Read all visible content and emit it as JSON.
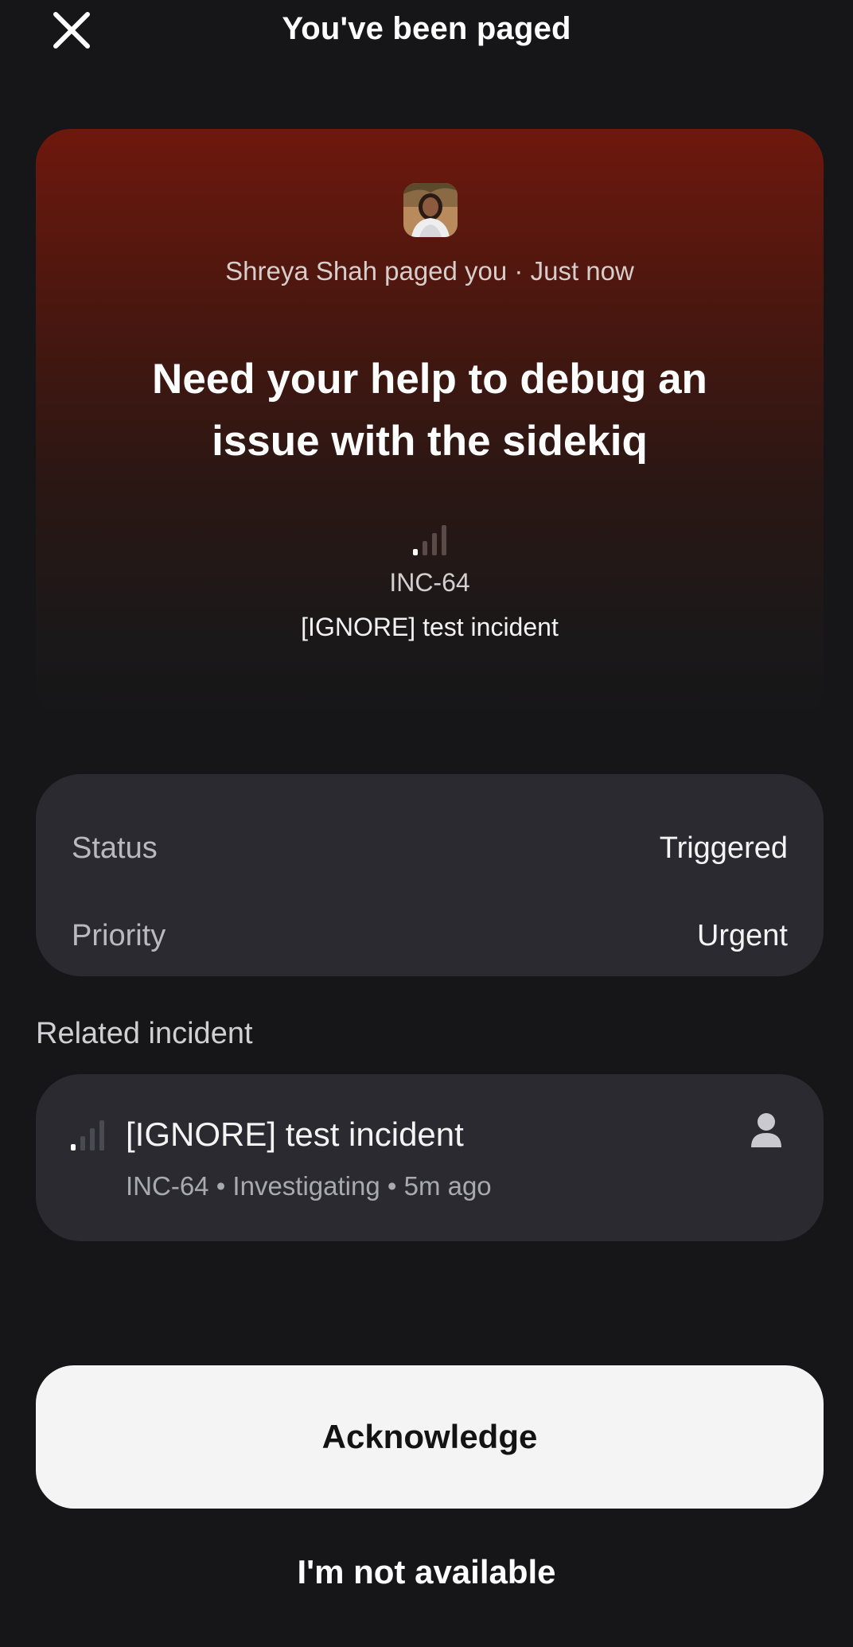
{
  "header": {
    "title": "You've been paged",
    "close_icon": "close-icon"
  },
  "page": {
    "avatar": "avatar-photo",
    "pager_text": "Shreya Shah paged you · Just now",
    "message": "Need your help to debug an issue with the sidekiq",
    "priority_icon": "signal-bars-icon",
    "incident_id": "INC-64",
    "incident_name": "[IGNORE] test incident",
    "accent_color": "#6e180d"
  },
  "details": {
    "status_label": "Status",
    "status_value": "Triggered",
    "priority_label": "Priority",
    "priority_value": "Urgent"
  },
  "related": {
    "section_label": "Related incident",
    "title": "[IGNORE] test incident",
    "meta": "INC-64 • Investigating • 5m ago",
    "user_icon": "person-icon"
  },
  "actions": {
    "acknowledge_label": "Acknowledge",
    "not_available_label": "I'm not available"
  }
}
